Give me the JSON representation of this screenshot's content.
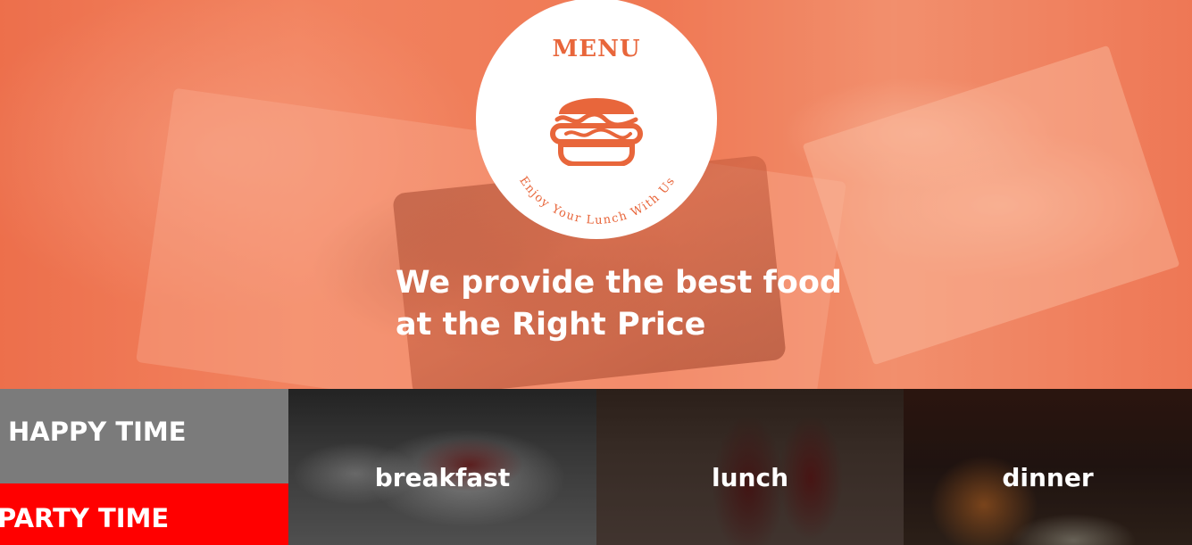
{
  "logo": {
    "title": "MENU",
    "arc_text": "Enjoy Your Lunch With Us",
    "icon": "burger-icon",
    "accent_color": "#e8663b"
  },
  "hero": {
    "tagline_line1": "We provide the best food",
    "tagline_line2_prefix": "at the",
    "tagline_line2_strong": "Right Price"
  },
  "side": {
    "happy_label": "HAPPY TIME",
    "happy_color": "#7b7b7b",
    "party_label": "PARTY TIME",
    "party_color": "#ff0000"
  },
  "meals": [
    {
      "label": "breakfast"
    },
    {
      "label": "lunch"
    },
    {
      "label": "dinner"
    }
  ]
}
